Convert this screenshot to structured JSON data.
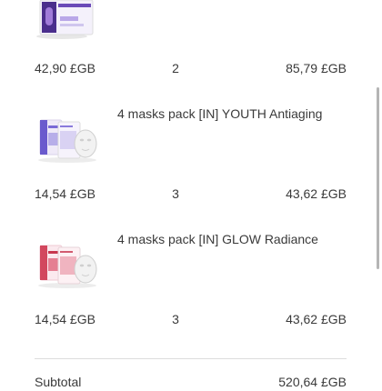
{
  "items": [
    {
      "title": "",
      "unit_price": "42,90 £GB",
      "quantity": "2",
      "total": "85,79 £GB",
      "thumb_icon": "moisturizer-box-icon"
    },
    {
      "title": "4 masks pack [IN] YOUTH Antiaging",
      "unit_price": "14,54 £GB",
      "quantity": "3",
      "total": "43,62 £GB",
      "thumb_icon": "youth-mask-pack-icon"
    },
    {
      "title": "4 masks pack [IN] GLOW Radiance",
      "unit_price": "14,54 £GB",
      "quantity": "3",
      "total": "43,62 £GB",
      "thumb_icon": "glow-mask-pack-icon"
    }
  ],
  "summary": {
    "label": "Subtotal",
    "value": "520,64 £GB"
  },
  "colors": {
    "youth_accent": "#6a5acd",
    "glow_accent": "#d2475e",
    "text": "#3a3a3a",
    "divider": "#dcdcdc"
  }
}
